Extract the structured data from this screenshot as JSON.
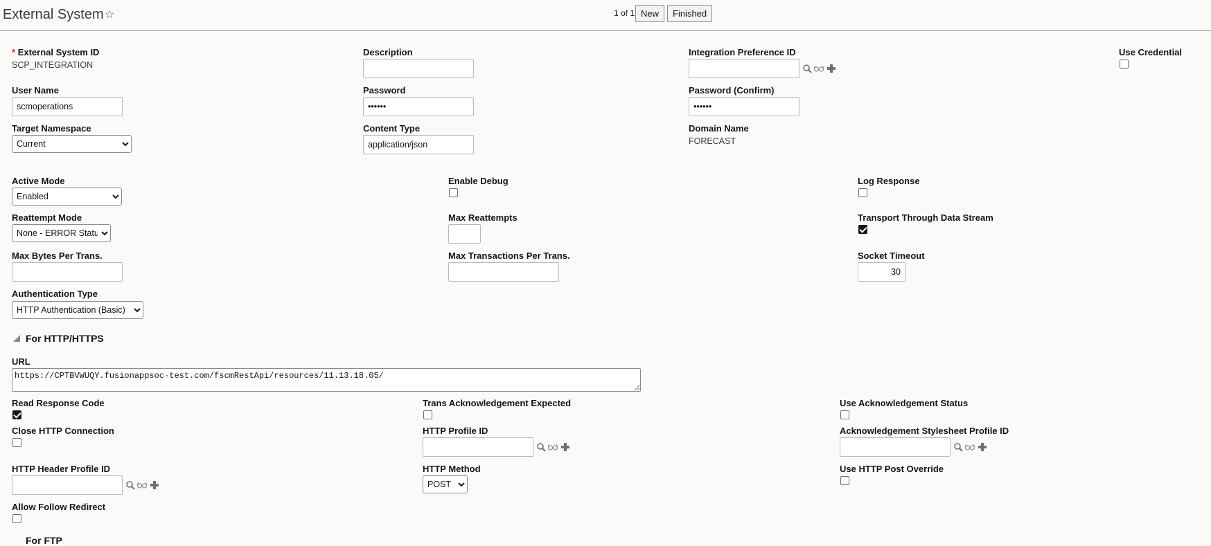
{
  "header": {
    "title": "External System",
    "pager": "1 of 1",
    "new_label": "New",
    "finished_label": "Finished"
  },
  "fields": {
    "external_system_id": {
      "label": "External System ID",
      "value": "SCP_INTEGRATION"
    },
    "description": {
      "label": "Description",
      "value": ""
    },
    "integration_pref_id": {
      "label": "Integration Preference ID",
      "value": ""
    },
    "use_credential": {
      "label": "Use Credential",
      "checked": false
    },
    "user_name": {
      "label": "User Name",
      "value": "scmoperations"
    },
    "password": {
      "label": "Password",
      "value": "••••••"
    },
    "password_confirm": {
      "label": "Password (Confirm)",
      "value": "••••••"
    },
    "target_namespace": {
      "label": "Target Namespace",
      "value": "Current"
    },
    "content_type": {
      "label": "Content Type",
      "value": "application/json"
    },
    "domain_name": {
      "label": "Domain Name",
      "value": "FORECAST"
    },
    "active_mode": {
      "label": "Active Mode",
      "value": "Enabled"
    },
    "enable_debug": {
      "label": "Enable Debug",
      "checked": false
    },
    "log_response": {
      "label": "Log Response",
      "checked": false
    },
    "reattempt_mode": {
      "label": "Reattempt Mode",
      "value": "None - ERROR Status"
    },
    "max_reattempts": {
      "label": "Max Reattempts",
      "value": ""
    },
    "transport_data_stream": {
      "label": "Transport Through Data Stream",
      "checked": true
    },
    "max_bytes": {
      "label": "Max Bytes Per Trans.",
      "value": ""
    },
    "max_transactions": {
      "label": "Max Transactions Per Trans.",
      "value": ""
    },
    "socket_timeout": {
      "label": "Socket Timeout",
      "value": "30"
    },
    "auth_type": {
      "label": "Authentication Type",
      "value": "HTTP Authentication (Basic)"
    }
  },
  "http_section": {
    "title": "For HTTP/HTTPS",
    "url": {
      "label": "URL",
      "value": "https://CPTBVWUQY.fusionappsoc-test.com/fscmRestApi/resources/11.13.18.05/"
    },
    "read_response_code": {
      "label": "Read Response Code",
      "checked": true
    },
    "trans_ack_expected": {
      "label": "Trans Acknowledgement Expected",
      "checked": false
    },
    "use_ack_status": {
      "label": "Use Acknowledgement Status",
      "checked": false
    },
    "close_http": {
      "label": "Close HTTP Connection",
      "checked": false
    },
    "http_profile_id": {
      "label": "HTTP Profile ID",
      "value": ""
    },
    "ack_stylesheet_id": {
      "label": "Acknowledgement Stylesheet Profile ID",
      "value": ""
    },
    "http_header_profile_id": {
      "label": "HTTP Header Profile ID",
      "value": ""
    },
    "http_method": {
      "label": "HTTP Method",
      "value": "POST"
    },
    "use_http_post_override": {
      "label": "Use HTTP Post Override",
      "checked": false
    },
    "allow_follow_redirect": {
      "label": "Allow Follow Redirect",
      "checked": false
    }
  },
  "next_section": {
    "title": "For FTP"
  },
  "icons": [
    "search-icon",
    "view-icon",
    "add-icon",
    "star-icon",
    "collapse-triangle-icon"
  ],
  "colors": {
    "required": "#d62b2b",
    "background": "#fbfaf9"
  }
}
